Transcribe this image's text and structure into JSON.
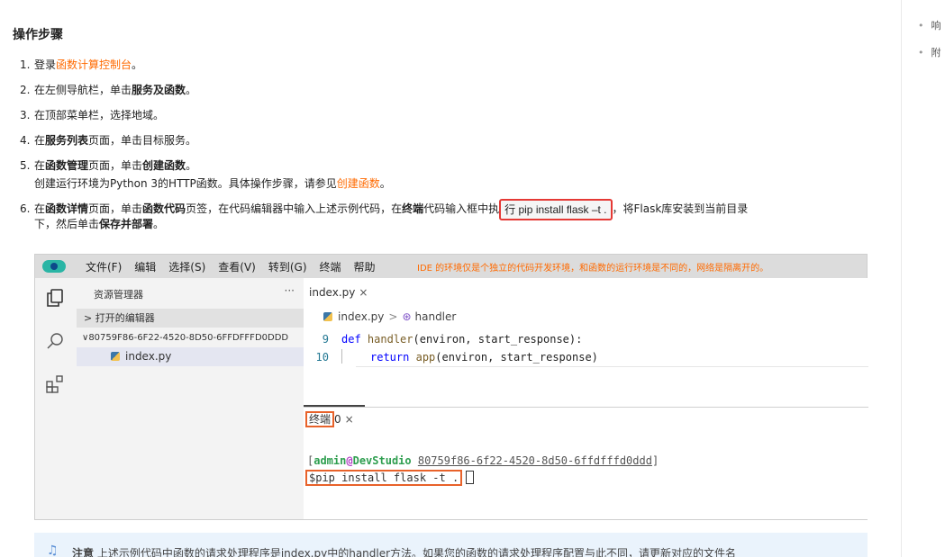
{
  "sidebar_right": {
    "items": [
      "响",
      "附"
    ]
  },
  "title": "操作步骤",
  "steps": {
    "s1": {
      "num": "1.",
      "pre": "登录",
      "link": "函数计算控制台",
      "post": "。"
    },
    "s2": {
      "num": "2.",
      "pre": "在左侧导航栏，单击",
      "bold": "服务及函数",
      "post": "。"
    },
    "s3": {
      "num": "3.",
      "text": "在顶部菜单栏，选择地域。"
    },
    "s4": {
      "num": "4.",
      "pre": "在",
      "bold": "服务列表",
      "post": "页面，单击目标服务。"
    },
    "s5": {
      "num": "5.",
      "pre": "在",
      "bold": "函数管理",
      "mid": "页面，单击",
      "bold2": "创建函数",
      "post": "。",
      "sub_pre": "创建运行环境为Python 3的HTTP函数。具体操作步骤，请参见",
      "sub_link": "创建函数",
      "sub_post": "。"
    },
    "s6": {
      "num": "6.",
      "a": "在",
      "b": "函数详情",
      "c": "页面，单击",
      "d": "函数代码",
      "e": "页签，在代码编辑器中输入上述示例代码，在",
      "f": "终端",
      "g": "代码输入框中执",
      "h": "行",
      "cmd": "pip install flask –t .",
      "i": "，将Flask库安装到当前目录",
      "j": "下，然后单击",
      "k": "保存并部署",
      "l": "。"
    }
  },
  "ide": {
    "menus": [
      "文件(F)",
      "编辑",
      "选择(S)",
      "查看(V)",
      "转到(G)",
      "终端",
      "帮助"
    ],
    "note": "IDE 的环境仅是个独立的代码开发环境，和函数的运行环境是不同的，网络是隔离开的。",
    "explorer": {
      "title": "资源管理器",
      "more": "···",
      "open_editors": "> 打开的编辑器",
      "folder": "∨80759F86-6F22-4520-8D50-6FFDFFFD0DDD",
      "file": "index.py"
    },
    "tab": {
      "label": "index.py",
      "close": "×"
    },
    "breadcrumb": {
      "file": "index.py",
      "sep": ">",
      "fn": "handler"
    },
    "code": [
      {
        "ln": "9",
        "kw": "def",
        "fn": "handler",
        "rest": "(environ, start_response):"
      },
      {
        "ln": "10",
        "kw": "return",
        "fn": "app",
        "rest": "(environ, start_response)"
      }
    ],
    "terminal": {
      "tab": "终端",
      "count": "0",
      "close": "×",
      "open_br": "[",
      "user": "admin",
      "at": "@",
      "host": "DevStudio",
      "path": "80759f86-6f22-4520-8d50-6ffdfffd0ddd",
      "close_br": "]",
      "cmd": "$pip install flask -t ."
    }
  },
  "notice": {
    "label": "注意",
    "text": "上述示例代码中函数的请求处理程序是index.py中的handler方法。如果您的函数的请求处理程序配置与此不同，请更新对应的文件名"
  }
}
